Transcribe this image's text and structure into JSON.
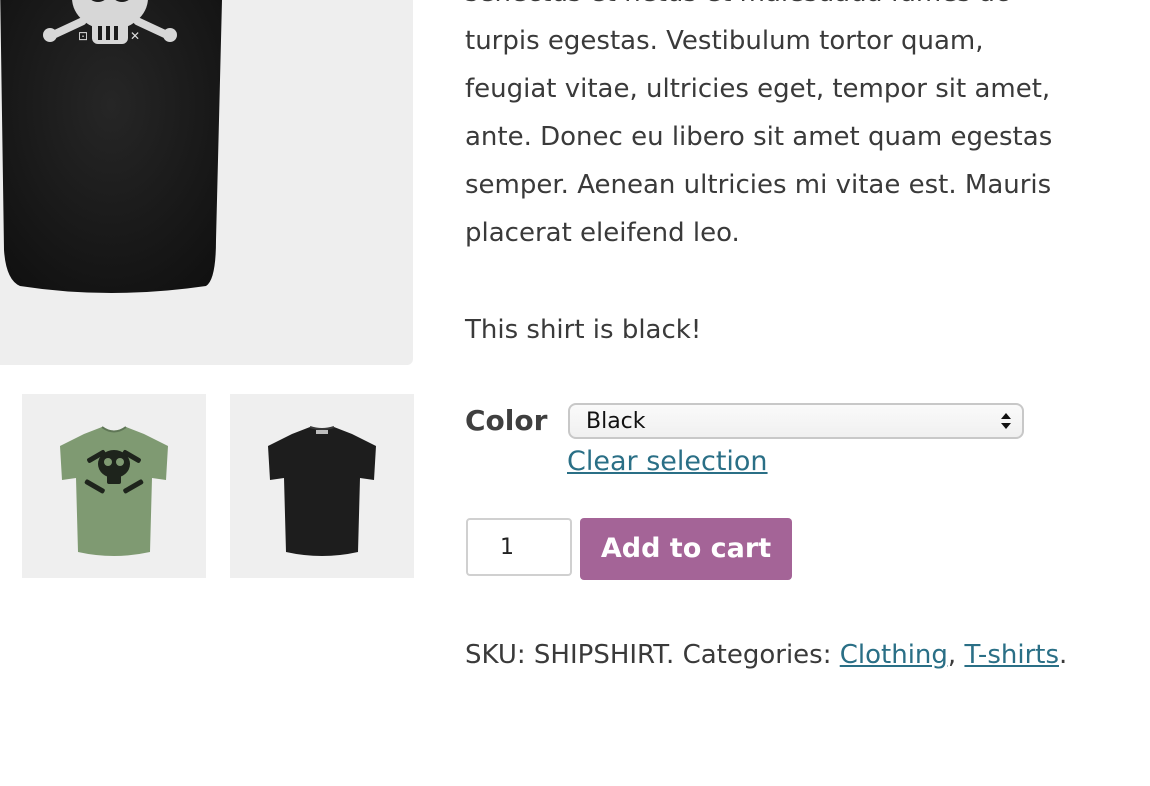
{
  "product": {
    "description_lines": [
      "senectus et netus et malesuada fames ac",
      "turpis egestas. Vestibulum tortor quam,",
      "feugiat vitae, ultricies eget, tempor sit amet,",
      "ante. Donec eu libero sit amet quam egestas",
      "semper. Aenean ultricies mi vitae est. Mauris",
      "placerat eleifend leo."
    ],
    "note": "This shirt is black!"
  },
  "variation": {
    "label": "Color",
    "selected": "Black",
    "clear_label": "Clear selection"
  },
  "cart": {
    "quantity": "1",
    "button_label": "Add to cart"
  },
  "meta": {
    "sku_label": "SKU:",
    "sku_value": "SHIPSHIRT",
    "categories_label": "Categories:",
    "categories": [
      "Clothing",
      "T-shirts"
    ]
  },
  "gallery": {
    "thumbnails": [
      {
        "icon": "green-tshirt-skull-thumbnail",
        "color": "#7f9a72"
      },
      {
        "icon": "black-tshirt-back-thumbnail",
        "color": "#1d1d1d"
      }
    ],
    "main_image": {
      "icon": "black-tshirt-skull-image",
      "color": "#1c1c1c"
    }
  },
  "colors": {
    "link": "#2a6f86",
    "button": "#a46497"
  }
}
